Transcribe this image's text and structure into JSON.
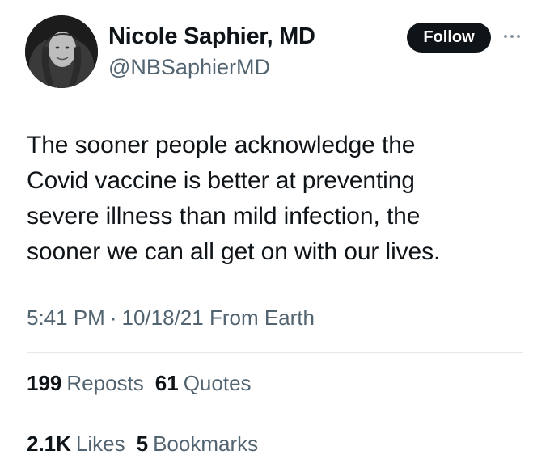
{
  "author": {
    "display_name": "Nicole Saphier, MD",
    "handle": "@NBSaphierMD"
  },
  "actions": {
    "follow_label": "Follow",
    "more_icon": "more-horizontal-icon"
  },
  "tweet": {
    "lines": [
      "The sooner people acknowledge the",
      "Covid vaccine is better at preventing",
      "severe illness than mild infection, the",
      "sooner we can all get on with our lives."
    ]
  },
  "meta": {
    "time": "5:41 PM",
    "separator": "·",
    "date": "10/18/21",
    "source": "From Earth"
  },
  "stats": {
    "reposts_count": "199",
    "reposts_label": "Reposts",
    "quotes_count": "61",
    "quotes_label": "Quotes",
    "likes_count": "2.1K",
    "likes_label": "Likes",
    "bookmarks_count": "5",
    "bookmarks_label": "Bookmarks"
  },
  "colors": {
    "text_primary": "#0f1419",
    "text_secondary": "#536471",
    "button_bg": "#0f1419",
    "button_text": "#ffffff",
    "divider": "#e6e9eb"
  }
}
